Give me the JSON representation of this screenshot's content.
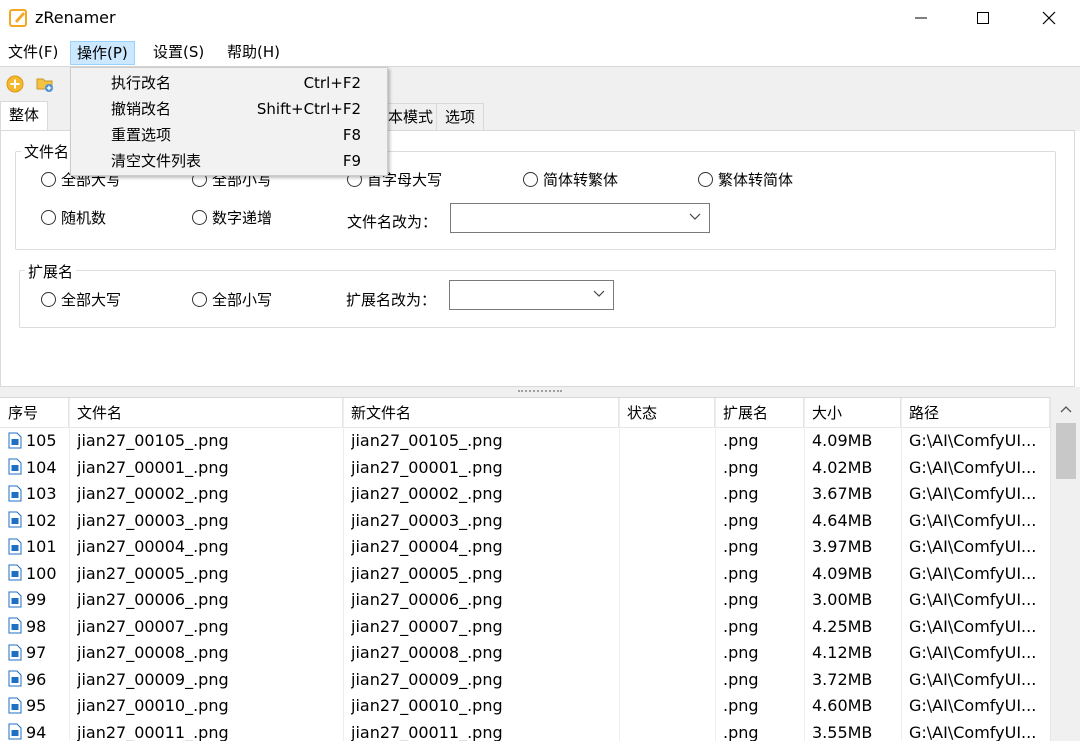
{
  "window": {
    "title": "zRenamer"
  },
  "menubar": {
    "items": [
      {
        "label": "文件(F)"
      },
      {
        "label": "操作(P)"
      },
      {
        "label": "设置(S)"
      },
      {
        "label": "帮助(H)"
      }
    ]
  },
  "dropdown": {
    "items": [
      {
        "label": "执行改名",
        "shortcut": "Ctrl+F2"
      },
      {
        "label": "撤销改名",
        "shortcut": "Shift+Ctrl+F2"
      },
      {
        "label": "重置选项",
        "shortcut": "F8"
      },
      {
        "label": "清空文件列表",
        "shortcut": "F9"
      }
    ]
  },
  "tabs": [
    {
      "label": "整体"
    },
    {
      "label": "本模式"
    },
    {
      "label": "选项"
    }
  ],
  "group_filename": {
    "label": "文件名",
    "radios": [
      "全部大写",
      "全部小写",
      "首字母大写",
      "简体转繁体",
      "繁体转简体",
      "随机数",
      "数字递增"
    ],
    "rename_label": "文件名改为：",
    "rename_value": ""
  },
  "group_ext": {
    "label": "扩展名",
    "radios": [
      "全部大写",
      "全部小写"
    ],
    "rename_label": "扩展名改为：",
    "rename_value": ""
  },
  "table": {
    "headers": [
      "序号",
      "文件名",
      "新文件名",
      "状态",
      "扩展名",
      "大小",
      "路径"
    ],
    "rows": [
      [
        "105",
        "jian27_00105_.png",
        "jian27_00105_.png",
        "",
        ".png",
        "4.09MB",
        "G:\\AI\\ComfyUI..."
      ],
      [
        "104",
        "jian27_00001_.png",
        "jian27_00001_.png",
        "",
        ".png",
        "4.02MB",
        "G:\\AI\\ComfyUI..."
      ],
      [
        "103",
        "jian27_00002_.png",
        "jian27_00002_.png",
        "",
        ".png",
        "3.67MB",
        "G:\\AI\\ComfyUI..."
      ],
      [
        "102",
        "jian27_00003_.png",
        "jian27_00003_.png",
        "",
        ".png",
        "4.64MB",
        "G:\\AI\\ComfyUI..."
      ],
      [
        "101",
        "jian27_00004_.png",
        "jian27_00004_.png",
        "",
        ".png",
        "3.97MB",
        "G:\\AI\\ComfyUI..."
      ],
      [
        "100",
        "jian27_00005_.png",
        "jian27_00005_.png",
        "",
        ".png",
        "4.09MB",
        "G:\\AI\\ComfyUI..."
      ],
      [
        "99",
        "jian27_00006_.png",
        "jian27_00006_.png",
        "",
        ".png",
        "3.00MB",
        "G:\\AI\\ComfyUI..."
      ],
      [
        "98",
        "jian27_00007_.png",
        "jian27_00007_.png",
        "",
        ".png",
        "4.25MB",
        "G:\\AI\\ComfyUI..."
      ],
      [
        "97",
        "jian27_00008_.png",
        "jian27_00008_.png",
        "",
        ".png",
        "4.12MB",
        "G:\\AI\\ComfyUI..."
      ],
      [
        "96",
        "jian27_00009_.png",
        "jian27_00009_.png",
        "",
        ".png",
        "3.72MB",
        "G:\\AI\\ComfyUI..."
      ],
      [
        "95",
        "jian27_00010_.png",
        "jian27_00010_.png",
        "",
        ".png",
        "4.60MB",
        "G:\\AI\\ComfyUI..."
      ],
      [
        "94",
        "jian27_00011_.png",
        "jian27_00011_.png",
        "",
        ".png",
        "3.55MB",
        "G:\\AI\\ComfyUI..."
      ]
    ]
  },
  "colors": {
    "menu_active_bg": "#cce8ff",
    "app_icon": "#f5a623",
    "file_icon": "#1f6fc5"
  }
}
